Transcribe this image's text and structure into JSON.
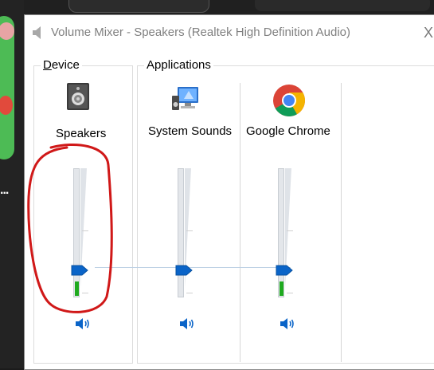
{
  "window": {
    "title": "Volume Mixer - Speakers (Realtek High Definition Audio)",
    "close_glyph": "X"
  },
  "device_group": {
    "label": "Device",
    "label_hotkey": "D",
    "label_rest": "evice",
    "channel": {
      "name": "Speakers",
      "icon": "speaker-device-icon",
      "volume_level": 0.21,
      "meter_level": 0.11
    }
  },
  "apps_group": {
    "label": "Applications",
    "channels": [
      {
        "name": "System Sounds",
        "icon": "system-sounds-icon",
        "volume_level": 0.21,
        "meter_level": 0
      },
      {
        "name": "Google Chrome",
        "icon": "chrome-icon",
        "volume_level": 0.21,
        "meter_level": 0.11
      }
    ]
  },
  "colors": {
    "accent": "#0a64c8",
    "meter_green": "#1faa1f",
    "annotation": "#d01818"
  },
  "background": {
    "overflow_text": "..."
  }
}
